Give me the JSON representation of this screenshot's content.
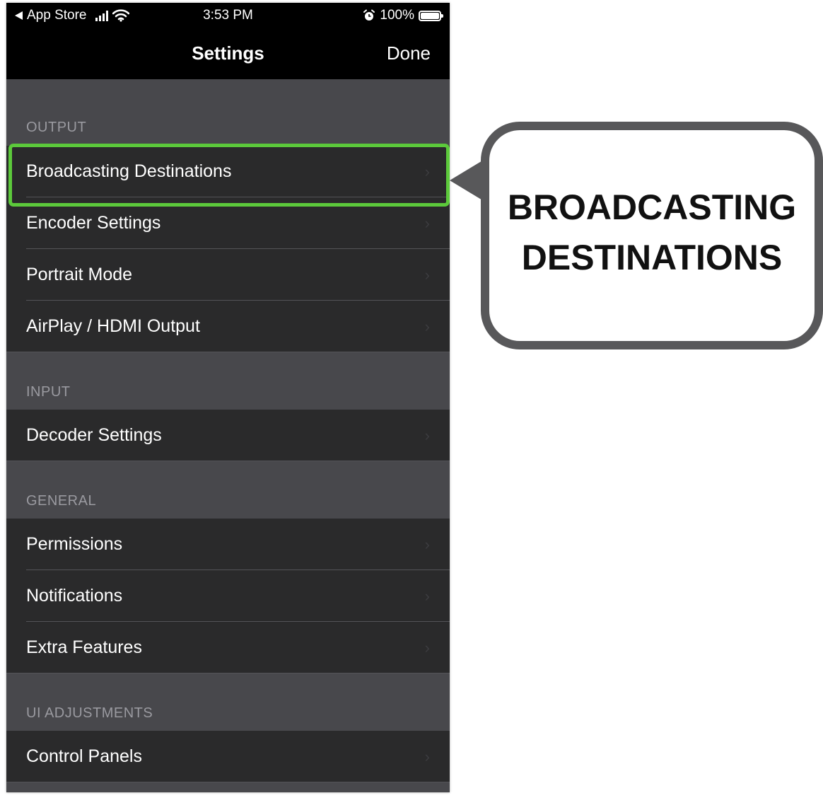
{
  "status_bar": {
    "back_app": "App Store",
    "time": "3:53 PM",
    "battery_percent": "100%",
    "icons": [
      "back-triangle-icon",
      "cellular-signal-icon",
      "wifi-icon",
      "alarm-icon",
      "battery-icon"
    ]
  },
  "nav": {
    "title": "Settings",
    "done": "Done"
  },
  "sections": {
    "output": {
      "header": "OUTPUT",
      "items": [
        "Broadcasting Destinations",
        "Encoder Settings",
        "Portrait Mode",
        "AirPlay / HDMI Output"
      ]
    },
    "input": {
      "header": "INPUT",
      "items": [
        "Decoder Settings"
      ]
    },
    "general": {
      "header": "GENERAL",
      "items": [
        "Permissions",
        "Notifications",
        "Extra Features"
      ]
    },
    "ui_adjustments": {
      "header": "UI ADJUSTMENTS",
      "items": [
        "Control Panels"
      ]
    }
  },
  "chevron": "›",
  "callout": {
    "line1": "BROADCASTING",
    "line2": "DESTINATIONS"
  },
  "colors": {
    "highlight": "#5cc93b",
    "callout_border": "#58585a",
    "row_background": "#2a2a2b",
    "group_background": "#48484c"
  }
}
